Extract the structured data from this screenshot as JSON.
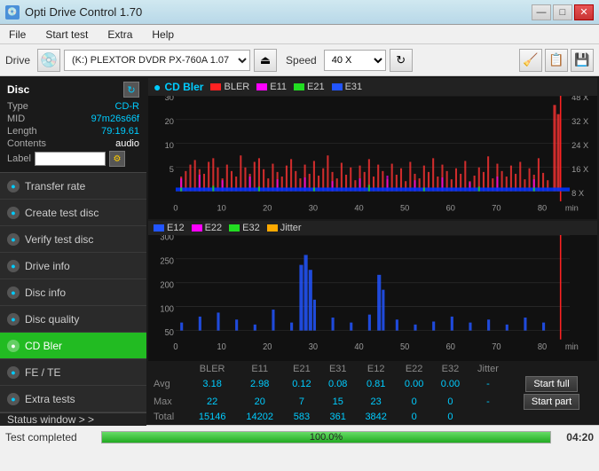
{
  "titlebar": {
    "title": "Opti Drive Control 1.70",
    "icon": "💿",
    "minimize": "—",
    "maximize": "□",
    "close": "✕"
  },
  "menubar": {
    "items": [
      "File",
      "Start test",
      "Extra",
      "Help"
    ]
  },
  "toolbar": {
    "drive_label": "Drive",
    "drive_value": "(K:)  PLEXTOR DVDR  PX-760A 1.07",
    "speed_label": "Speed",
    "speed_value": "40 X"
  },
  "disc": {
    "title": "Disc",
    "type_label": "Type",
    "type_value": "CD-R",
    "mid_label": "MID",
    "mid_value": "97m26s66f",
    "length_label": "Length",
    "length_value": "79:19.61",
    "contents_label": "Contents",
    "contents_value": "audio",
    "label_label": "Label",
    "label_value": ""
  },
  "sidebar": {
    "items": [
      {
        "id": "transfer-rate",
        "label": "Transfer rate",
        "active": false
      },
      {
        "id": "create-test-disc",
        "label": "Create test disc",
        "active": false
      },
      {
        "id": "verify-test-disc",
        "label": "Verify test disc",
        "active": false
      },
      {
        "id": "drive-info",
        "label": "Drive info",
        "active": false
      },
      {
        "id": "disc-info",
        "label": "Disc info",
        "active": false
      },
      {
        "id": "disc-quality",
        "label": "Disc quality",
        "active": false
      },
      {
        "id": "cd-bler",
        "label": "CD Bler",
        "active": true
      },
      {
        "id": "fe-te",
        "label": "FE / TE",
        "active": false
      },
      {
        "id": "extra-tests",
        "label": "Extra tests",
        "active": false
      }
    ],
    "status_window": "Status window > >"
  },
  "chart1": {
    "title": "CD Bler",
    "legend": [
      {
        "label": "BLER",
        "color": "#ff2222"
      },
      {
        "label": "E11",
        "color": "#ff00ff"
      },
      {
        "label": "E21",
        "color": "#22dd22"
      },
      {
        "label": "E31",
        "color": "#2255ff"
      }
    ],
    "y_max": 30,
    "x_max": 80,
    "y_right_labels": [
      "48 X",
      "32 X",
      "24 X",
      "16 X",
      "8 X"
    ],
    "x_labels": [
      "0",
      "10",
      "20",
      "30",
      "40",
      "50",
      "60",
      "70",
      "80"
    ],
    "x_unit": "min"
  },
  "chart2": {
    "legend": [
      {
        "label": "E12",
        "color": "#2255ff"
      },
      {
        "label": "E22",
        "color": "#ff00ff"
      },
      {
        "label": "E32",
        "color": "#22dd22"
      },
      {
        "label": "Jitter",
        "color": "#ffaa00"
      }
    ],
    "y_max": 300,
    "x_max": 80,
    "x_labels": [
      "0",
      "10",
      "20",
      "30",
      "40",
      "50",
      "60",
      "70",
      "80"
    ],
    "x_unit": "min"
  },
  "stats": {
    "headers": [
      "",
      "BLER",
      "E11",
      "E21",
      "E31",
      "E12",
      "E22",
      "E32",
      "Jitter",
      ""
    ],
    "rows": [
      {
        "label": "Avg",
        "values": [
          "3.18",
          "2.98",
          "0.12",
          "0.08",
          "0.81",
          "0.00",
          "0.00",
          "-"
        ]
      },
      {
        "label": "Max",
        "values": [
          "22",
          "20",
          "7",
          "15",
          "23",
          "0",
          "0",
          "-"
        ]
      },
      {
        "label": "Total",
        "values": [
          "15146",
          "14202",
          "583",
          "361",
          "3842",
          "0",
          "0",
          ""
        ]
      }
    ],
    "buttons": [
      "Start full",
      "Start part"
    ]
  },
  "statusbar": {
    "status_text": "Test completed",
    "progress": 100.0,
    "progress_text": "100.0%",
    "time": "04:20"
  }
}
